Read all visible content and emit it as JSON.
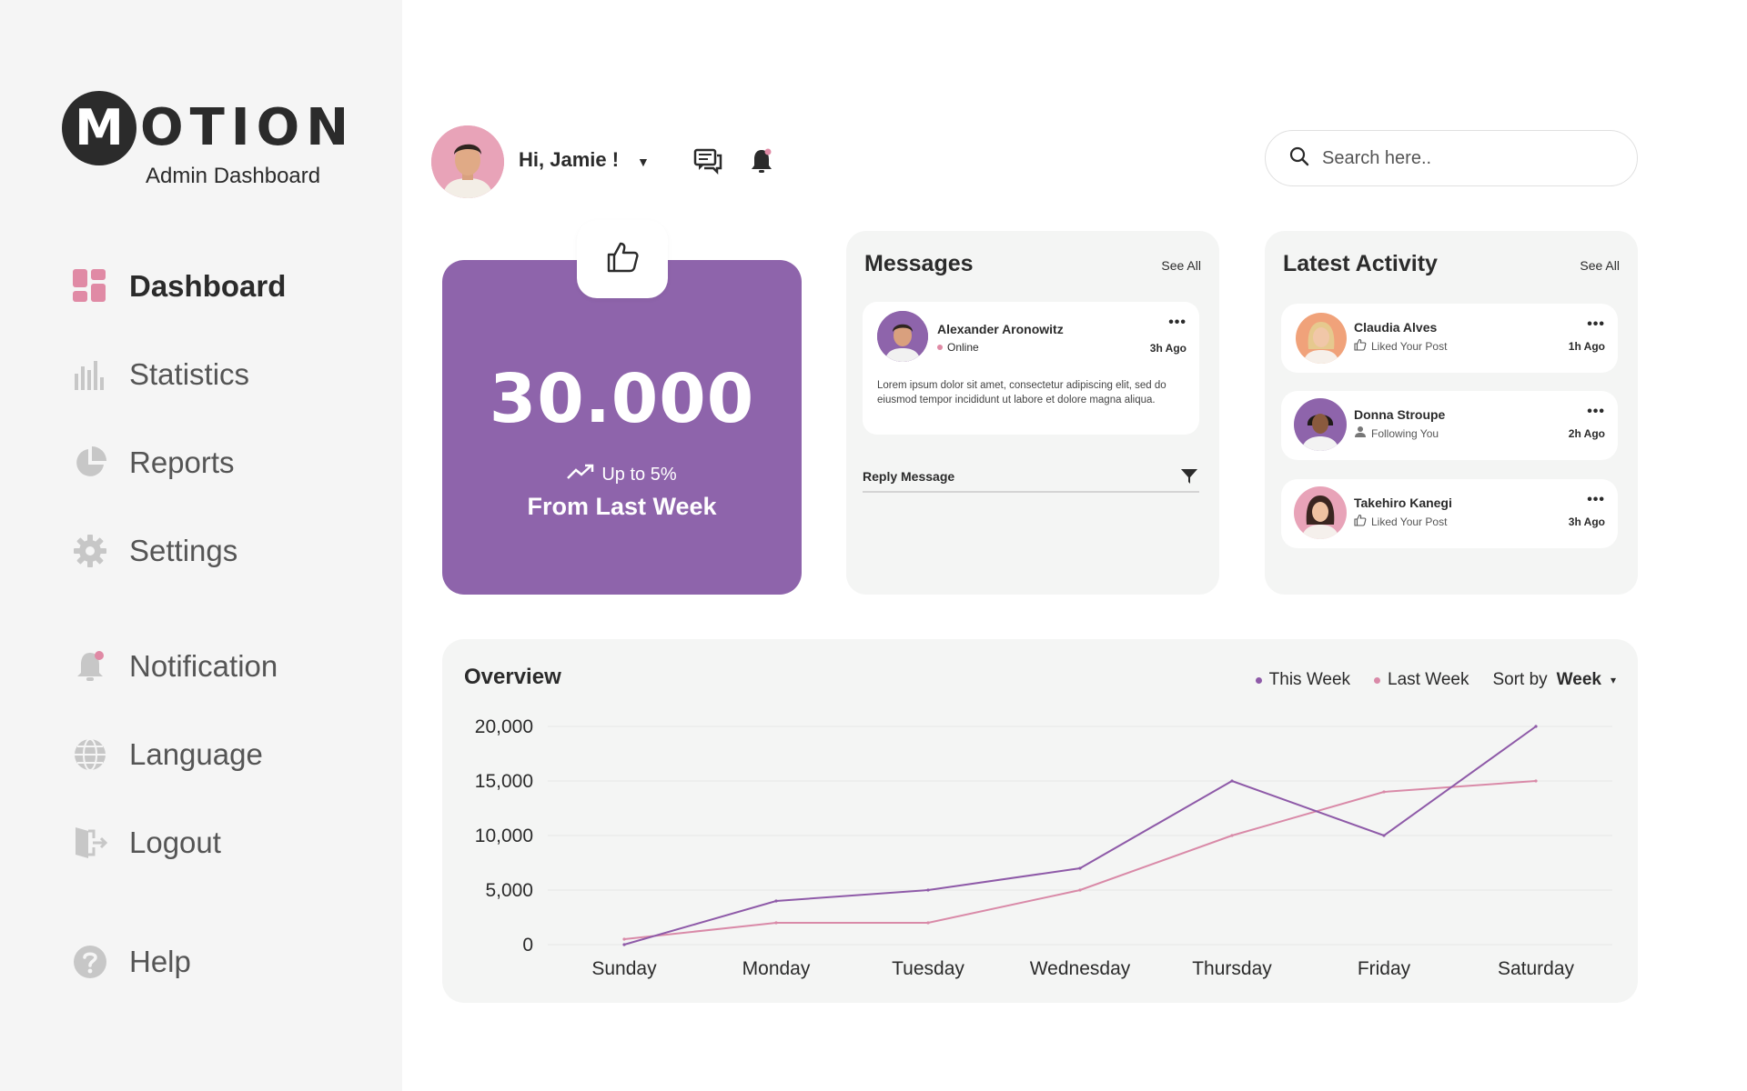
{
  "brand": {
    "logo_letter": "M",
    "logo_text": "OTION",
    "subtitle": "Admin Dashboard"
  },
  "sidebar": {
    "items": [
      {
        "label": "Dashboard",
        "icon": "grid-icon",
        "active": true
      },
      {
        "label": "Statistics",
        "icon": "bar-chart-icon"
      },
      {
        "label": "Reports",
        "icon": "pie-chart-icon"
      },
      {
        "label": "Settings",
        "icon": "gear-icon"
      },
      {
        "label": "Notification",
        "icon": "bell-icon"
      },
      {
        "label": "Language",
        "icon": "globe-icon"
      },
      {
        "label": "Logout",
        "icon": "logout-icon"
      },
      {
        "label": "Help",
        "icon": "help-icon"
      }
    ]
  },
  "header": {
    "greeting": "Hi, Jamie !",
    "caret": "▼",
    "search_placeholder": "Search here.."
  },
  "stat": {
    "value": "30.000",
    "trend": "Up to 5%",
    "subtitle": "From Last Week"
  },
  "messages": {
    "title": "Messages",
    "see_all": "See All",
    "item": {
      "name": "Alexander Aronowitz",
      "status": "Online",
      "time": "3h Ago",
      "body": "Lorem ipsum dolor sit amet, consectetur adipiscing elit, sed do eiusmod tempor incididunt ut labore et dolore magna aliqua."
    },
    "reply_label": "Reply Message"
  },
  "activity": {
    "title": "Latest Activity",
    "see_all": "See All",
    "items": [
      {
        "name": "Claudia Alves",
        "action": "Liked Your Post",
        "time": "1h Ago",
        "icon": "thumbs-up-icon"
      },
      {
        "name": "Donna Stroupe",
        "action": "Following You",
        "time": "2h Ago",
        "icon": "user-icon"
      },
      {
        "name": "Takehiro Kanegi",
        "action": "Liked Your Post",
        "time": "3h Ago",
        "icon": "thumbs-up-icon"
      }
    ]
  },
  "overview": {
    "title": "Overview",
    "legend_this_week": "This Week",
    "legend_last_week": "Last Week",
    "sort_label": "Sort by",
    "sort_value": "Week",
    "sort_caret": "▾"
  },
  "colors": {
    "accent": "#8e64ab",
    "pink": "#d98aa8",
    "panel": "#f4f5f4",
    "sidebar": "#f5f5f5"
  },
  "chart_data": {
    "type": "line",
    "title": "Overview",
    "categories": [
      "Sunday",
      "Monday",
      "Tuesday",
      "Wednesday",
      "Thursday",
      "Friday",
      "Saturday"
    ],
    "series": [
      {
        "name": "This Week",
        "color": "#8e5aa8",
        "values": [
          0,
          4000,
          5000,
          7000,
          15000,
          10000,
          20000
        ]
      },
      {
        "name": "Last Week",
        "color": "#d98aa8",
        "values": [
          500,
          2000,
          2000,
          5000,
          10000,
          14000,
          15000
        ]
      }
    ],
    "yticks": [
      0,
      5000,
      10000,
      15000,
      20000
    ],
    "ytick_labels": [
      "0",
      "5,000",
      "10,000",
      "15,000",
      "20,000"
    ],
    "ylim": [
      0,
      20000
    ],
    "grid": true,
    "legend": "top-right"
  }
}
